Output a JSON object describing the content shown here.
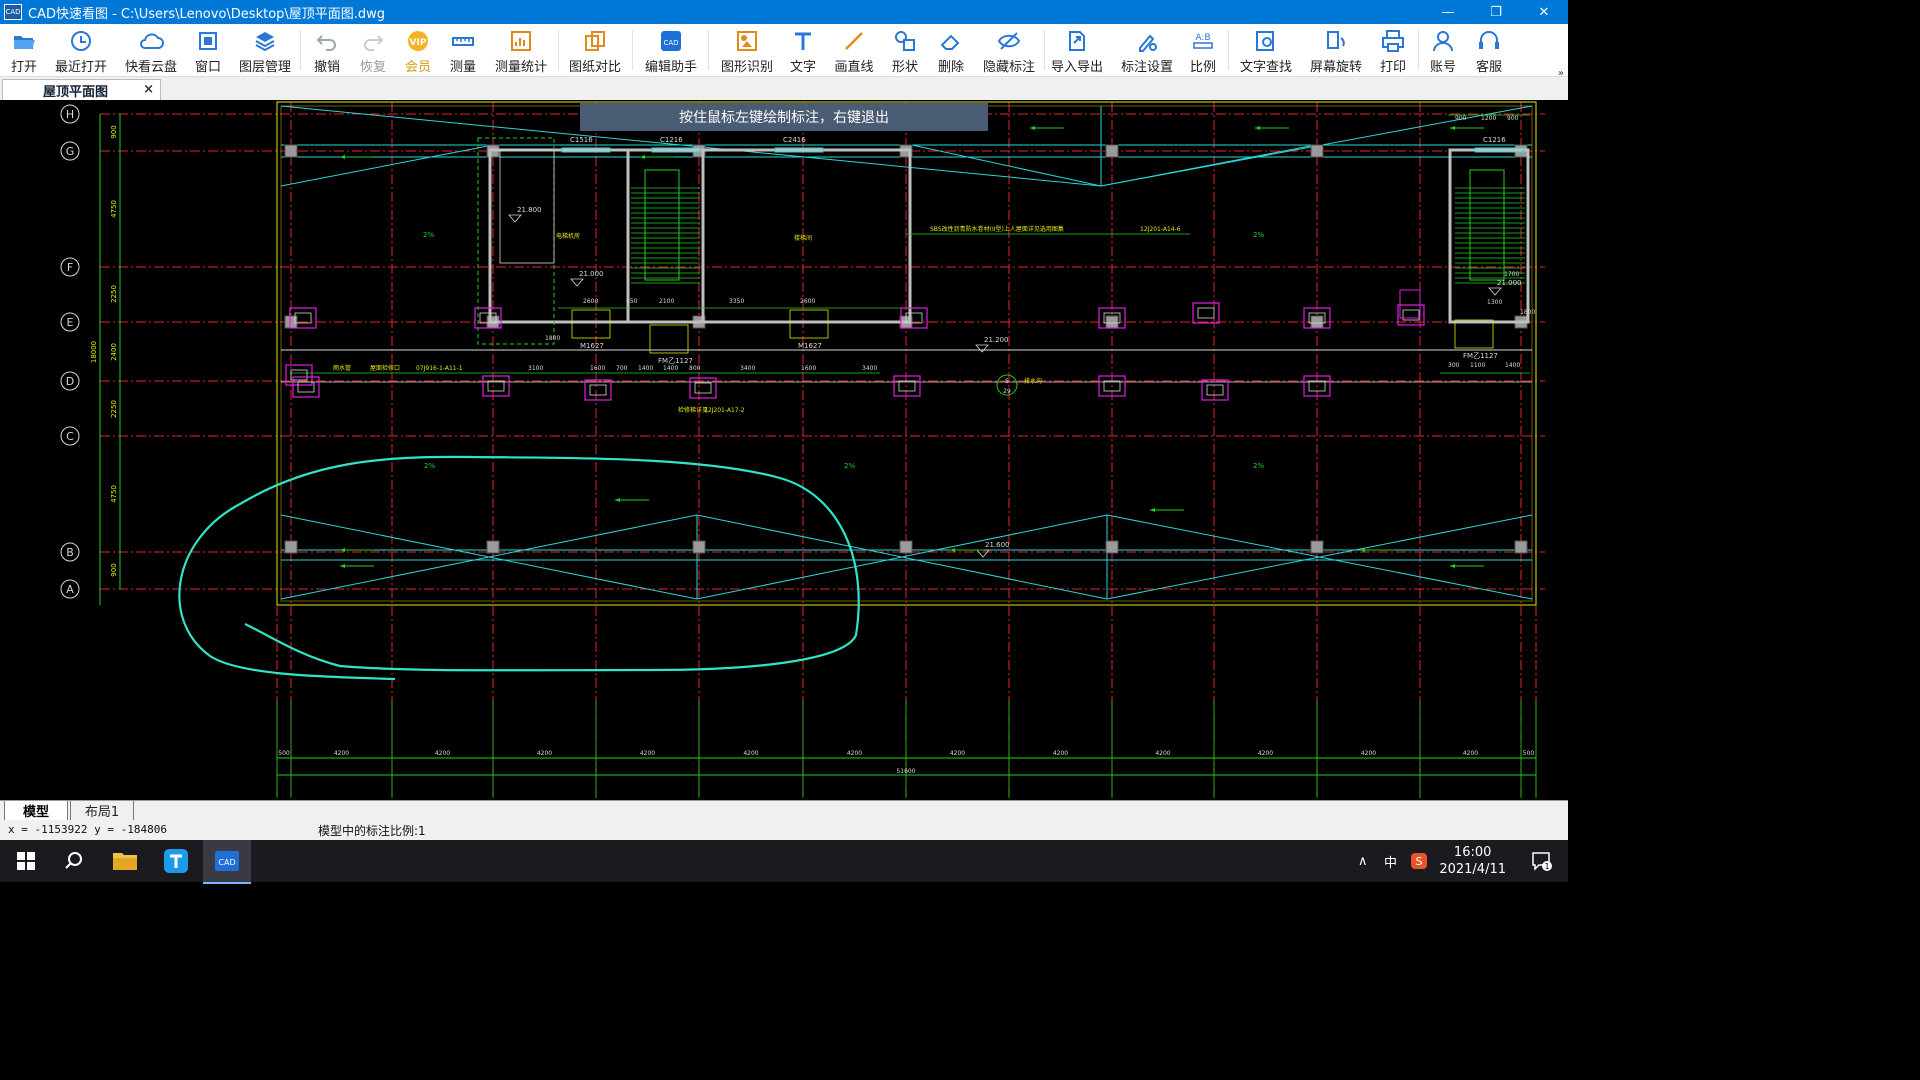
{
  "window": {
    "app_icon_text": "CAD",
    "title": "CAD快速看图 - C:\\Users\\Lenovo\\Desktop\\屋顶平面图.dwg"
  },
  "toolbar": {
    "items": [
      {
        "label": "打开",
        "icon": "folder-open-icon"
      },
      {
        "label": "最近打开",
        "icon": "recent-clock-icon"
      },
      {
        "label": "快看云盘",
        "icon": "cloud-icon"
      },
      {
        "label": "窗口",
        "icon": "window-icon"
      },
      {
        "label": "图层管理",
        "icon": "layers-icon"
      },
      {
        "label": "撤销",
        "icon": "undo-icon"
      },
      {
        "label": "恢复",
        "icon": "redo-icon"
      },
      {
        "label": "会员",
        "icon": "vip-icon"
      },
      {
        "label": "测量",
        "icon": "ruler-icon"
      },
      {
        "label": "测量统计",
        "icon": "measure-stats-icon"
      },
      {
        "label": "图纸对比",
        "icon": "compare-icon"
      },
      {
        "label": "编辑助手",
        "icon": "edit-assistant-icon"
      },
      {
        "label": "图形识别",
        "icon": "shape-recognize-icon"
      },
      {
        "label": "文字",
        "icon": "text-icon"
      },
      {
        "label": "画直线",
        "icon": "line-icon"
      },
      {
        "label": "形状",
        "icon": "shapes-icon"
      },
      {
        "label": "删除",
        "icon": "eraser-icon"
      },
      {
        "label": "隐藏标注",
        "icon": "hide-eye-icon"
      },
      {
        "label": "导入导出",
        "icon": "import-export-icon"
      },
      {
        "label": "标注设置",
        "icon": "annotation-settings-icon"
      },
      {
        "label": "比例",
        "icon": "scale-icon"
      },
      {
        "label": "文字查找",
        "icon": "text-search-icon"
      },
      {
        "label": "屏幕旋转",
        "icon": "rotate-icon"
      },
      {
        "label": "打印",
        "icon": "printer-icon"
      },
      {
        "label": "账号",
        "icon": "user-icon"
      },
      {
        "label": "客服",
        "icon": "headset-icon"
      }
    ],
    "more": "»"
  },
  "doc_tab": {
    "label": "屋顶平面图",
    "close": "×"
  },
  "canvas": {
    "hint_banner": "按住鼠标左键绘制标注，右键退出",
    "grid_axes": [
      "H",
      "G",
      "F",
      "E",
      "D",
      "C",
      "B",
      "A"
    ],
    "grid_spacings": [
      "900",
      "4750",
      "2250",
      "2400",
      "2250",
      "4750",
      "900"
    ],
    "total_height": "18000",
    "bottom_spans": [
      "500",
      "4200",
      "4200",
      "4200",
      "4200",
      "4200",
      "4200",
      "4200",
      "4200",
      "4200",
      "4200",
      "4200",
      "4200",
      "500"
    ],
    "total_width": "51600",
    "top_right_dims": [
      "900",
      "1200",
      "900"
    ],
    "room_labels": [
      "电梯机房",
      "楼梯间"
    ],
    "window_tags": [
      "C1516",
      "C1216",
      "C2416",
      "C1216"
    ],
    "door_tags": [
      "M1627",
      "M1627",
      "FM乙1127",
      "FM乙1127"
    ],
    "elevations": [
      "21.800",
      "21.000",
      "21.200",
      "21.000",
      "21.600"
    ],
    "slopes": [
      "2%",
      "2%",
      "2%",
      "2%",
      "2%",
      "2%"
    ],
    "notes": [
      "SBS改性沥青防水卷材(II型)上人屋面详见选用图集",
      "12J201-A14-6",
      "07J916-1-A11-1",
      "12J201-A17-2",
      "雨水管",
      "屋面检修口",
      "排水沟",
      "检修梯详见",
      "5",
      "29"
    ],
    "room_dims": [
      "2600",
      "650",
      "2100",
      "3350",
      "2600",
      "1800",
      "3100",
      "1600",
      "700",
      "1400",
      "1400",
      "800",
      "3400",
      "1600",
      "3400",
      "1700",
      "300",
      "1100",
      "1400",
      "1800",
      "1300"
    ]
  },
  "layouts": {
    "model": "模型",
    "layout1": "布局1"
  },
  "status": {
    "coords": "x = -1153922  y = -184806",
    "scale_text": "模型中的标注比例:1"
  },
  "taskbar": {
    "ime": "中",
    "time": "16:00",
    "date": "2021/4/11",
    "notify_count": "1"
  }
}
